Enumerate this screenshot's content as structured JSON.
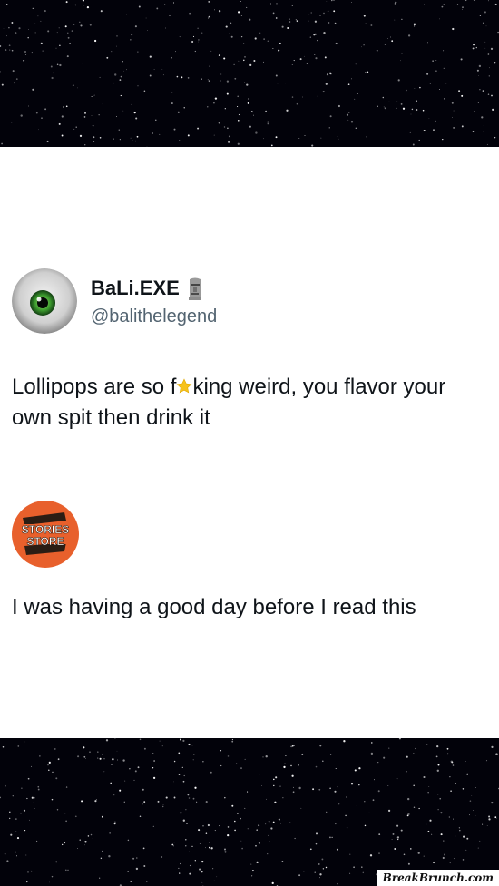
{
  "tweet": {
    "display_name": "BaLi.EXE",
    "handle": "@balithelegend",
    "text_before": "Lollipops are so f",
    "text_after": "king weird, you flavor your own spit then drink it",
    "verified_emoji_icon": "moai-icon",
    "censor_icon": "star-emoji-icon"
  },
  "reply": {
    "logo_line1": "STORIES",
    "logo_line2": "STORE",
    "logo_color": "#e8602c",
    "text": "I was having a good day before I read this"
  },
  "watermark": "BreakBrunch.com",
  "colors": {
    "card_bg": "#ffffff",
    "text": "#0f1419",
    "handle": "#536471",
    "space_bg": "#02020a"
  }
}
